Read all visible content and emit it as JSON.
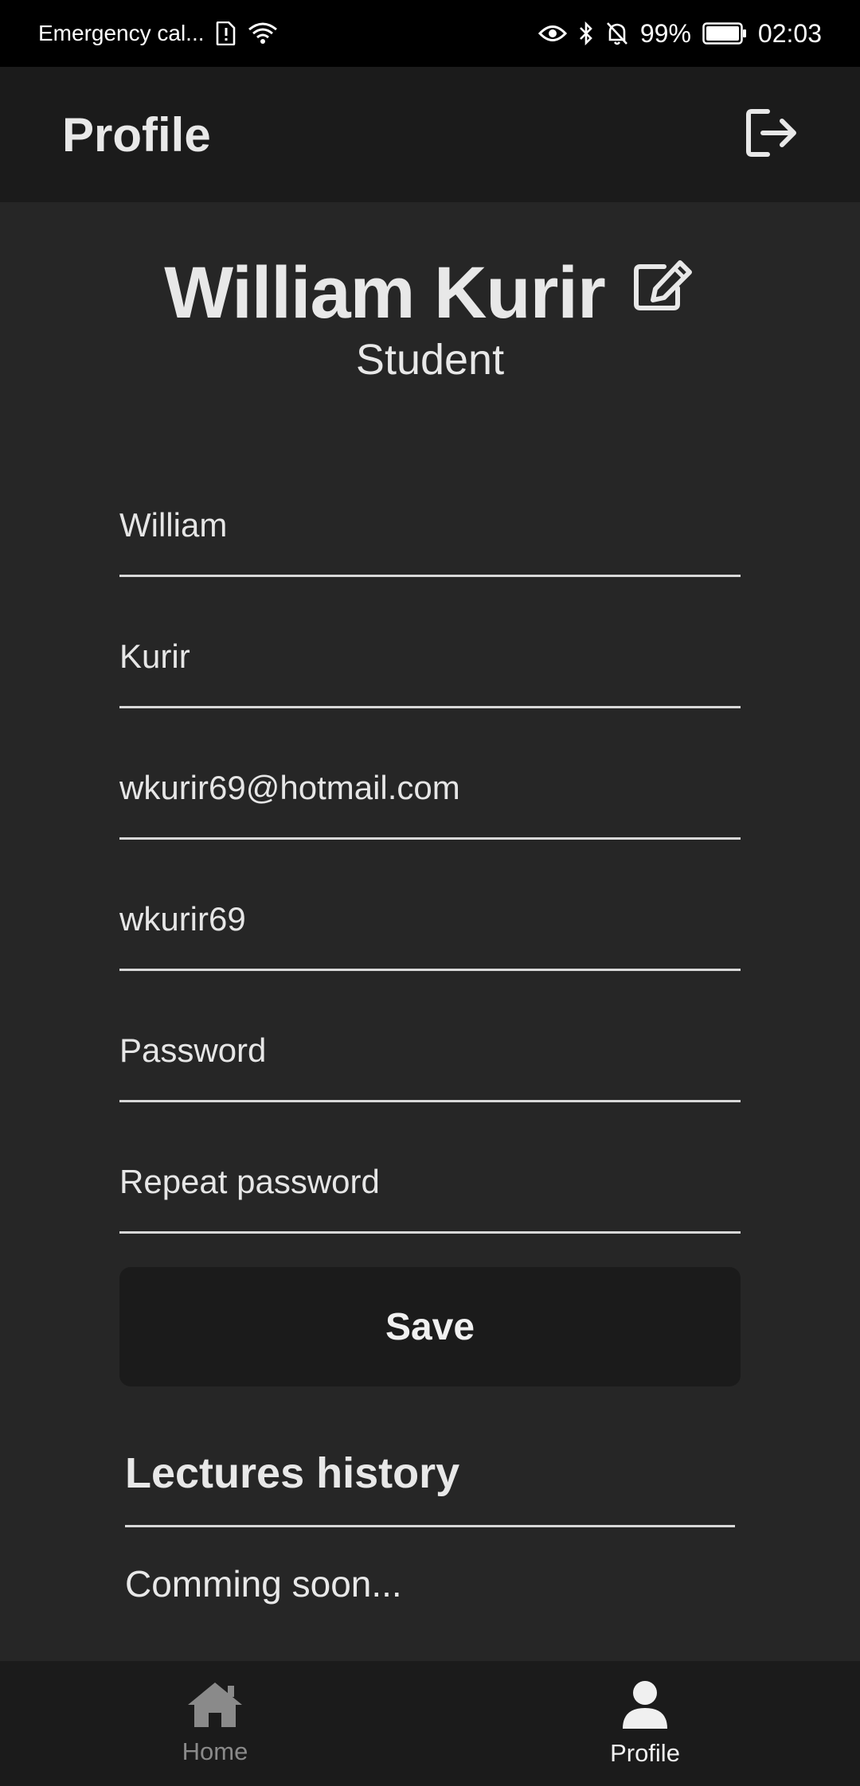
{
  "status_bar": {
    "carrier": "Emergency cal...",
    "battery": "99%",
    "time": "02:03",
    "icons": [
      "sim-alert-icon",
      "wifi-icon",
      "eye-icon",
      "bluetooth-icon",
      "bell-off-icon",
      "battery-icon"
    ]
  },
  "app_bar": {
    "title": "Profile",
    "logout_icon": "logout-icon"
  },
  "profile": {
    "full_name": "William Kurir",
    "role": "Student",
    "edit_icon": "edit-icon"
  },
  "form": {
    "first_name": "William",
    "last_name": "Kurir",
    "email": "wkurir69@hotmail.com",
    "username": "wkurir69",
    "password_placeholder": "Password",
    "repeat_password_placeholder": "Repeat password",
    "save_label": "Save"
  },
  "lectures": {
    "title": "Lectures history",
    "empty_text": "Comming soon..."
  },
  "bottom_nav": {
    "items": [
      {
        "label": "Home",
        "icon": "home-icon",
        "active": false
      },
      {
        "label": "Profile",
        "icon": "person-icon",
        "active": true
      }
    ]
  },
  "colors": {
    "background": "#262626",
    "bars": "#1b1b1b",
    "status_bar": "#000000",
    "text": "#e8e8e8",
    "inactive": "#8a8a8a"
  }
}
